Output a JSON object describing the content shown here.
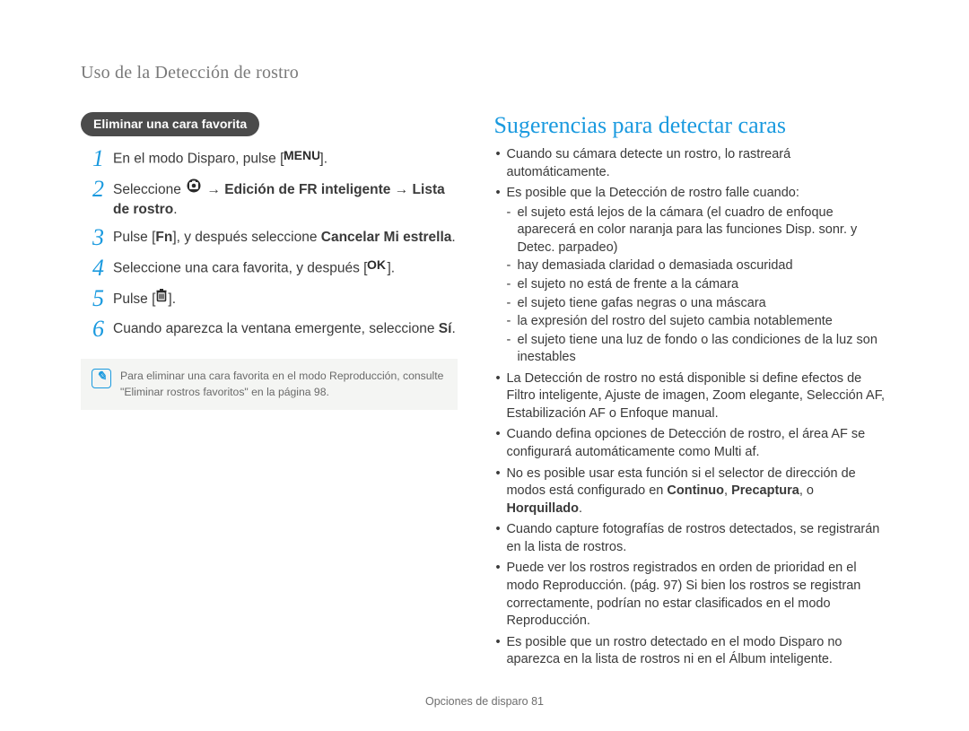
{
  "header": "Uso de la Detección de rostro",
  "left": {
    "pill": "Eliminar una cara favorita",
    "steps": {
      "s1a": "En el modo Disparo, pulse [",
      "s1b": "].",
      "s2a": "Seleccione ",
      "s2b": " → ",
      "s2c": "Edición de FR inteligente",
      "s2d": " → ",
      "s2e": "Lista de rostro",
      "s2f": ".",
      "s3a": "Pulse [",
      "s3b": "Fn",
      "s3c": "], y después seleccione ",
      "s3d": "Cancelar Mi estrella",
      "s3e": ".",
      "s4a": "Seleccione una cara favorita, y después [",
      "s4b": "].",
      "s5a": "Pulse [",
      "s5b": "].",
      "s6a": "Cuando aparezca la ventana emergente, seleccione ",
      "s6b": "Sí",
      "s6c": "."
    },
    "nums": [
      "1",
      "2",
      "3",
      "4",
      "5",
      "6"
    ],
    "note": "Para eliminar una cara favorita en el modo Reproducción, consulte \"Eliminar rostros favoritos\" en la página 98."
  },
  "right": {
    "title": "Sugerencias para detectar caras",
    "b1": "Cuando su cámara detecte un rostro, lo rastreará automáticamente.",
    "b2": "Es posible que la Detección de rostro falle cuando:",
    "b2subs": [
      "el sujeto está lejos de la cámara (el cuadro de enfoque aparecerá en color naranja para las funciones Disp. sonr. y Detec. parpadeo)",
      "hay demasiada claridad o demasiada oscuridad",
      "el sujeto no está de frente a la cámara",
      "el sujeto tiene gafas negras o una máscara",
      "la expresión del rostro del sujeto cambia notablemente",
      "el sujeto tiene una luz de fondo o las condiciones de la luz son inestables"
    ],
    "b3": "La Detección de rostro no está disponible si define efectos de Filtro inteligente, Ajuste de imagen, Zoom elegante, Selección AF, Estabilización AF o Enfoque manual.",
    "b4": "Cuando defina opciones de Detección de rostro, el área AF se configurará automáticamente como Multi af.",
    "b5a": "No es posible usar esta función si el selector de dirección de modos está configurado en ",
    "b5b": "Continuo",
    "b5c": ", ",
    "b5d": "Precaptura",
    "b5e": ", o ",
    "b5f": "Horquillado",
    "b5g": ".",
    "b6": "Cuando capture fotografías de rostros detectados, se registrarán en la lista de rostros.",
    "b7": "Puede ver los rostros registrados en orden de prioridad en el modo Reproducción. (pág. 97) Si bien los rostros se registran correctamente, podrían no estar clasificados en el modo Reproducción.",
    "b8": "Es posible que un rostro detectado en el modo Disparo no aparezca en la lista de rostros ni en el Álbum inteligente."
  },
  "footer_label": "Opciones de disparo  ",
  "footer_page": "81"
}
